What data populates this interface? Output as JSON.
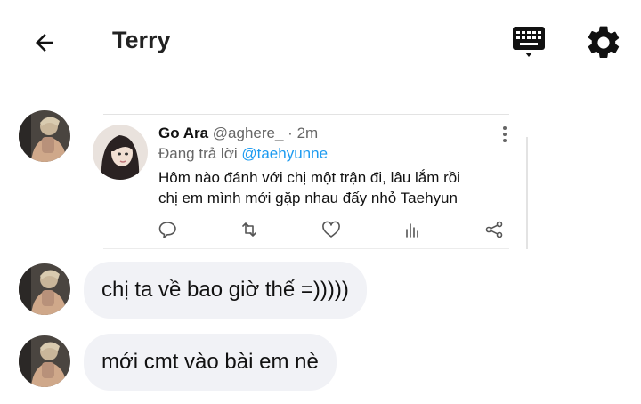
{
  "header": {
    "title": "Terry"
  },
  "tweet": {
    "name": "Go Ara",
    "handle": "@aghere_",
    "dot": "·",
    "time": "2m",
    "reply_prefix": "Đang trả lời",
    "reply_mention": "@taehyunne",
    "body_line1": "Hôm nào đánh với chị một trận đi, lâu lắm rồi",
    "body_line2": "chị em mình mới gặp nhau đấy nhỏ Taehyun"
  },
  "messages": [
    {
      "text": "chị ta về bao giờ thế =)))))"
    },
    {
      "text": "mới cmt vào bài em nè"
    }
  ],
  "icons": {
    "back": "arrow-left-icon",
    "keyboard": "keyboard-icon",
    "settings": "gear-icon",
    "reply": "comment-icon",
    "retweet": "retweet-icon",
    "like": "heart-icon",
    "stats": "bar-chart-icon",
    "share": "share-icon",
    "more": "more-vertical-icon"
  },
  "colors": {
    "mention": "#1d9bf0",
    "bubble": "#f1f2f6",
    "meta_text": "#666666"
  }
}
